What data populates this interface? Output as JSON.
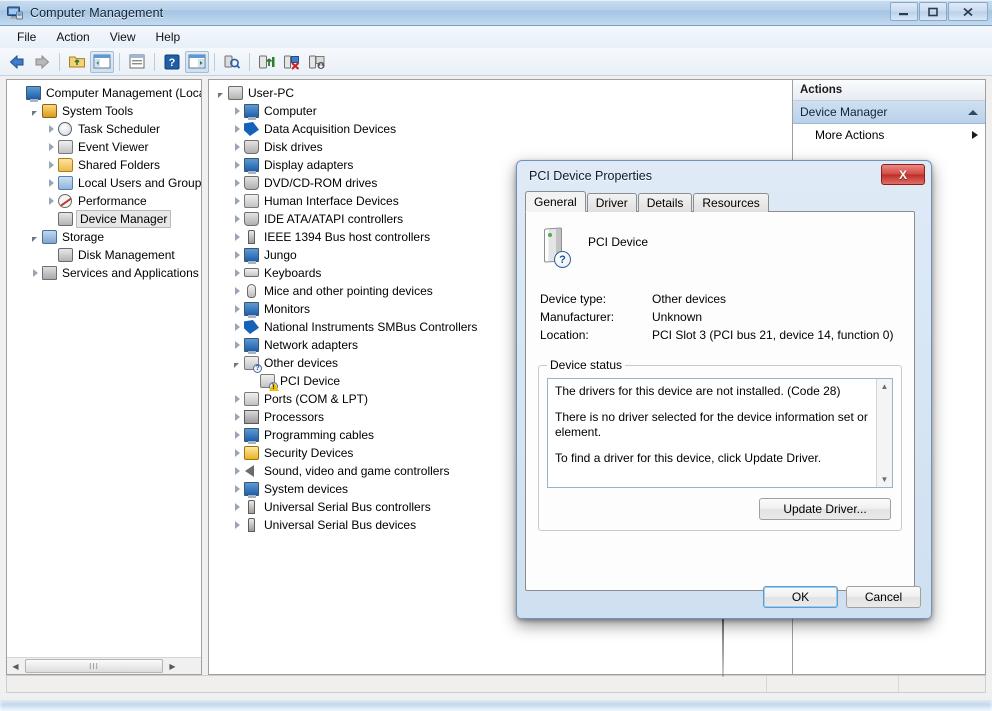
{
  "window": {
    "title": "Computer Management",
    "title_icon": "computer-management-icon",
    "controls": {
      "minimize": "—",
      "maximize": "▫",
      "close": "X"
    }
  },
  "menubar": {
    "items": [
      "File",
      "Action",
      "View",
      "Help"
    ]
  },
  "toolbar": {
    "buttons": [
      {
        "name": "back-icon",
        "glyph": "⬅"
      },
      {
        "name": "forward-icon",
        "glyph": "➡"
      },
      {
        "name": "up-folder-icon",
        "glyph": "📁"
      },
      {
        "name": "show-hide-tree-icon",
        "glyph": "▥"
      },
      {
        "name": "properties-icon",
        "glyph": "▤"
      },
      {
        "name": "help-icon",
        "glyph": "?"
      },
      {
        "name": "show-console-tree-icon",
        "glyph": "▶"
      },
      {
        "name": "scan-hardware-icon",
        "glyph": "🔍"
      },
      {
        "name": "update-driver-icon",
        "glyph": "⬆"
      },
      {
        "name": "uninstall-device-icon",
        "glyph": "✖"
      },
      {
        "name": "disable-device-icon",
        "glyph": "⬇"
      }
    ]
  },
  "console_tree": {
    "root": "Computer Management (Local",
    "items": [
      {
        "label": "Computer Management (Local",
        "indent": 0,
        "twisty": "none",
        "icon": "computer-icon",
        "selected": false
      },
      {
        "label": "System Tools",
        "indent": 1,
        "twisty": "open",
        "icon": "tools-icon",
        "selected": false
      },
      {
        "label": "Task Scheduler",
        "indent": 2,
        "twisty": "closed",
        "icon": "clock-icon",
        "selected": false
      },
      {
        "label": "Event Viewer",
        "indent": 2,
        "twisty": "closed",
        "icon": "event-viewer-icon",
        "selected": false
      },
      {
        "label": "Shared Folders",
        "indent": 2,
        "twisty": "closed",
        "icon": "shared-folders-icon",
        "selected": false
      },
      {
        "label": "Local Users and Groups",
        "indent": 2,
        "twisty": "closed",
        "icon": "users-icon",
        "selected": false
      },
      {
        "label": "Performance",
        "indent": 2,
        "twisty": "closed",
        "icon": "performance-icon",
        "selected": false
      },
      {
        "label": "Device Manager",
        "indent": 2,
        "twisty": "none",
        "icon": "device-manager-icon",
        "selected": true
      },
      {
        "label": "Storage",
        "indent": 1,
        "twisty": "open",
        "icon": "storage-icon",
        "selected": false
      },
      {
        "label": "Disk Management",
        "indent": 2,
        "twisty": "none",
        "icon": "disk-management-icon",
        "selected": false
      },
      {
        "label": "Services and Applications",
        "indent": 1,
        "twisty": "closed",
        "icon": "services-icon",
        "selected": false
      }
    ],
    "hscroll_thumb_glyph": "III"
  },
  "device_tree": {
    "items": [
      {
        "label": "User-PC",
        "indent": 0,
        "twisty": "open",
        "icon": "computer-host-icon",
        "warning": false
      },
      {
        "label": "Computer",
        "indent": 1,
        "twisty": "closed",
        "icon": "computer-icon",
        "warning": false
      },
      {
        "label": "Data Acquisition Devices",
        "indent": 1,
        "twisty": "closed",
        "icon": "ni-device-icon",
        "warning": false
      },
      {
        "label": "Disk drives",
        "indent": 1,
        "twisty": "closed",
        "icon": "disk-drive-icon",
        "warning": false
      },
      {
        "label": "Display adapters",
        "indent": 1,
        "twisty": "closed",
        "icon": "display-adapter-icon",
        "warning": false
      },
      {
        "label": "DVD/CD-ROM drives",
        "indent": 1,
        "twisty": "closed",
        "icon": "dvd-drive-icon",
        "warning": false
      },
      {
        "label": "Human Interface Devices",
        "indent": 1,
        "twisty": "closed",
        "icon": "hid-icon",
        "warning": false
      },
      {
        "label": "IDE ATA/ATAPI controllers",
        "indent": 1,
        "twisty": "closed",
        "icon": "ide-controller-icon",
        "warning": false
      },
      {
        "label": "IEEE 1394 Bus host controllers",
        "indent": 1,
        "twisty": "closed",
        "icon": "firewire-icon",
        "warning": false
      },
      {
        "label": "Jungo",
        "indent": 1,
        "twisty": "closed",
        "icon": "network-icon",
        "warning": false
      },
      {
        "label": "Keyboards",
        "indent": 1,
        "twisty": "closed",
        "icon": "keyboard-icon",
        "warning": false
      },
      {
        "label": "Mice and other pointing devices",
        "indent": 1,
        "twisty": "closed",
        "icon": "mouse-icon",
        "warning": false
      },
      {
        "label": "Monitors",
        "indent": 1,
        "twisty": "closed",
        "icon": "monitor-icon",
        "warning": false
      },
      {
        "label": "National Instruments SMBus Controllers",
        "indent": 1,
        "twisty": "closed",
        "icon": "ni-device-icon",
        "warning": false
      },
      {
        "label": "Network adapters",
        "indent": 1,
        "twisty": "closed",
        "icon": "network-icon",
        "warning": false
      },
      {
        "label": "Other devices",
        "indent": 1,
        "twisty": "open",
        "icon": "unknown-device-icon",
        "warning": false
      },
      {
        "label": "PCI Device",
        "indent": 2,
        "twisty": "none",
        "icon": "unknown-device-icon",
        "warning": true
      },
      {
        "label": "Ports (COM & LPT)",
        "indent": 1,
        "twisty": "closed",
        "icon": "port-icon",
        "warning": false
      },
      {
        "label": "Processors",
        "indent": 1,
        "twisty": "closed",
        "icon": "processor-icon",
        "warning": false
      },
      {
        "label": "Programming cables",
        "indent": 1,
        "twisty": "closed",
        "icon": "network-icon",
        "warning": false
      },
      {
        "label": "Security Devices",
        "indent": 1,
        "twisty": "closed",
        "icon": "security-key-icon",
        "warning": false
      },
      {
        "label": "Sound, video and game controllers",
        "indent": 1,
        "twisty": "closed",
        "icon": "speaker-icon",
        "warning": false
      },
      {
        "label": "System devices",
        "indent": 1,
        "twisty": "closed",
        "icon": "computer-icon",
        "warning": false
      },
      {
        "label": "Universal Serial Bus controllers",
        "indent": 1,
        "twisty": "closed",
        "icon": "usb-icon",
        "warning": false
      },
      {
        "label": "Universal Serial Bus devices",
        "indent": 1,
        "twisty": "closed",
        "icon": "usb-icon",
        "warning": false
      }
    ]
  },
  "actions_pane": {
    "header": "Actions",
    "section": "Device Manager",
    "rows": [
      "More Actions"
    ]
  },
  "statusbar": {
    "cell1": "",
    "cell2": "",
    "cell3": ""
  },
  "dialog": {
    "title": "PCI Device Properties",
    "close_label": "X",
    "tabs": [
      {
        "label": "General",
        "active": true
      },
      {
        "label": "Driver",
        "active": false
      },
      {
        "label": "Details",
        "active": false
      },
      {
        "label": "Resources",
        "active": false
      }
    ],
    "device_name": "PCI Device",
    "device_icon": "unknown-pci-device-icon",
    "fields": [
      {
        "label": "Device type:",
        "value": "Other devices"
      },
      {
        "label": "Manufacturer:",
        "value": "Unknown"
      },
      {
        "label": "Location:",
        "value": "PCI Slot 3 (PCI bus 21, device 14, function 0)"
      }
    ],
    "status_group_label": "Device status",
    "status_paragraphs": [
      "The drivers for this device are not installed. (Code 28)",
      "There is no driver selected for the device information set or element.",
      "To find a driver for this device, click Update Driver."
    ],
    "update_button": "Update Driver...",
    "ok_button": "OK",
    "cancel_button": "Cancel"
  },
  "colors": {
    "titlebar_accent": "#b4cfe9",
    "selection_blue": "#cfe0f2",
    "close_red": "#d24b43",
    "warning_yellow": "#f0c000",
    "window_chrome": "#f0f0f0"
  }
}
